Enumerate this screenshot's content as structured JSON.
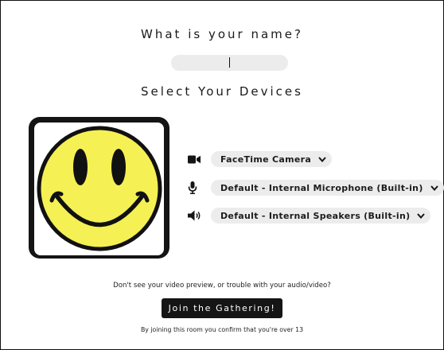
{
  "name_prompt": "What is your name?",
  "name_input": {
    "value": "",
    "placeholder": ""
  },
  "devices_heading": "Select Your Devices",
  "preview": {
    "image": "smiley-face",
    "face_color": "#f5f054"
  },
  "devices": {
    "camera": {
      "icon": "video-camera-icon",
      "selected": "FaceTime Camera"
    },
    "microphone": {
      "icon": "microphone-icon",
      "selected": "Default - Internal Microphone (Built-in)"
    },
    "speaker": {
      "icon": "speaker-icon",
      "selected": "Default - Internal Speakers (Built-in)"
    }
  },
  "help_text": "Don't see your video preview, or trouble with your audio/video?",
  "join_button": "Join the Gathering!",
  "disclaimer": "By joining this room you confirm that you're over 13",
  "colors": {
    "button_bg": "#151515",
    "input_bg": "#ececec",
    "face": "#f5f054"
  }
}
